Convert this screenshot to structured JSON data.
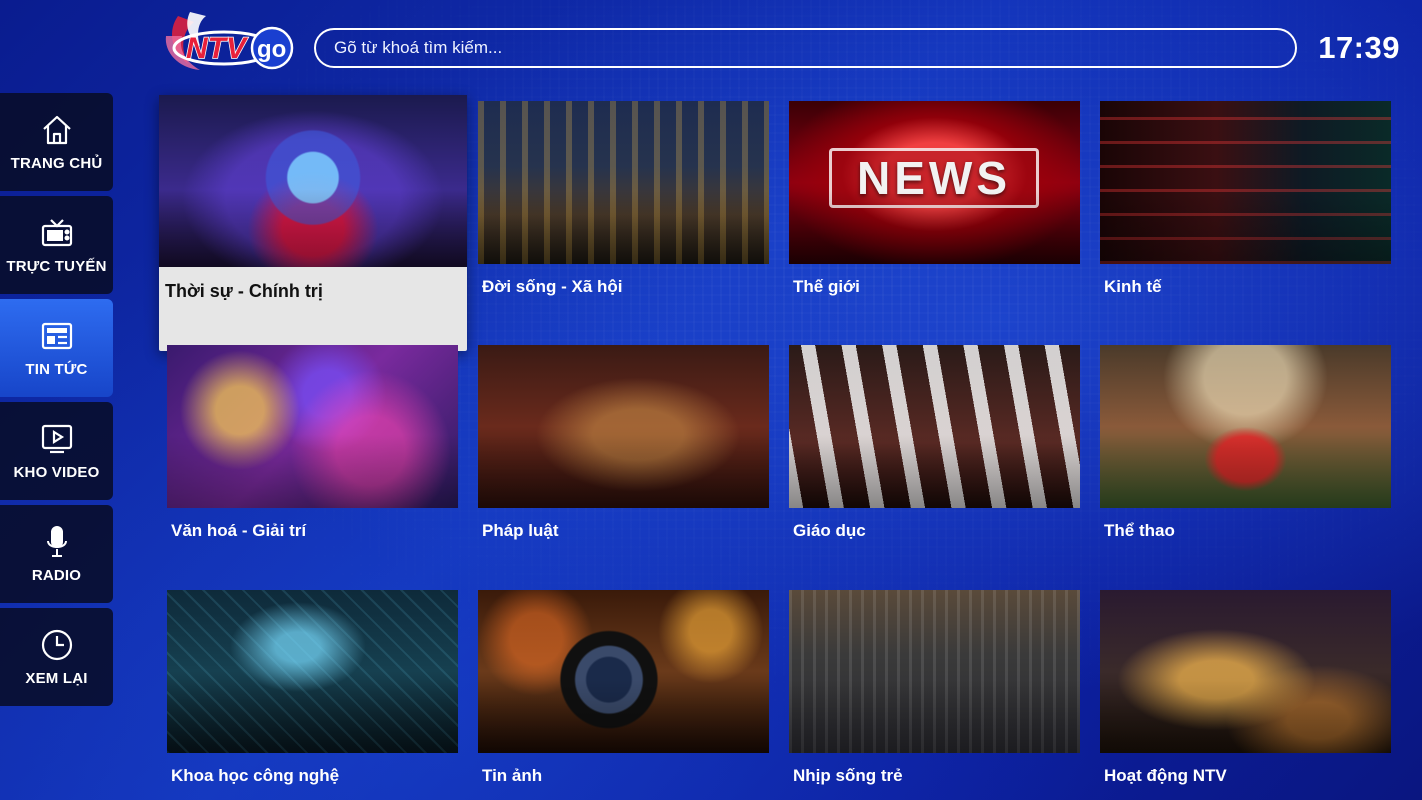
{
  "app": {
    "logo_text": "NTV",
    "logo_suffix": "go"
  },
  "search": {
    "placeholder": "Gõ từ khoá tìm kiếm..."
  },
  "clock": "17:39",
  "sidebar": {
    "items": [
      {
        "label": "TRANG CHỦ",
        "icon": "home-icon",
        "active": false
      },
      {
        "label": "TRỰC TUYẾN",
        "icon": "tv-icon",
        "active": false
      },
      {
        "label": "TIN TỨC",
        "icon": "newspaper-icon",
        "active": true
      },
      {
        "label": "KHO VIDEO",
        "icon": "video-library-icon",
        "active": false
      },
      {
        "label": "RADIO",
        "icon": "microphone-icon",
        "active": false
      },
      {
        "label": "XEM LẠI",
        "icon": "clock-icon",
        "active": false
      }
    ]
  },
  "categories": [
    {
      "title": "Thời sự - Chính trị",
      "focused": true
    },
    {
      "title": "Đời sống - Xã hội"
    },
    {
      "title": "Thế giới",
      "thumb_text": "NEWS"
    },
    {
      "title": "Kinh tế"
    },
    {
      "title": "Văn hoá - Giải trí"
    },
    {
      "title": "Pháp luật"
    },
    {
      "title": "Giáo dục"
    },
    {
      "title": "Thể thao"
    },
    {
      "title": "Khoa học công nghệ"
    },
    {
      "title": "Tin ảnh"
    },
    {
      "title": "Nhịp sống trẻ"
    },
    {
      "title": "Hoạt động NTV"
    }
  ],
  "colors": {
    "background": "#1232b8",
    "sidebar_active": "#2e6cf0",
    "sidebar_bg": "#080c28",
    "logo_red": "#e8203a",
    "logo_blue": "#1a3fd0"
  }
}
